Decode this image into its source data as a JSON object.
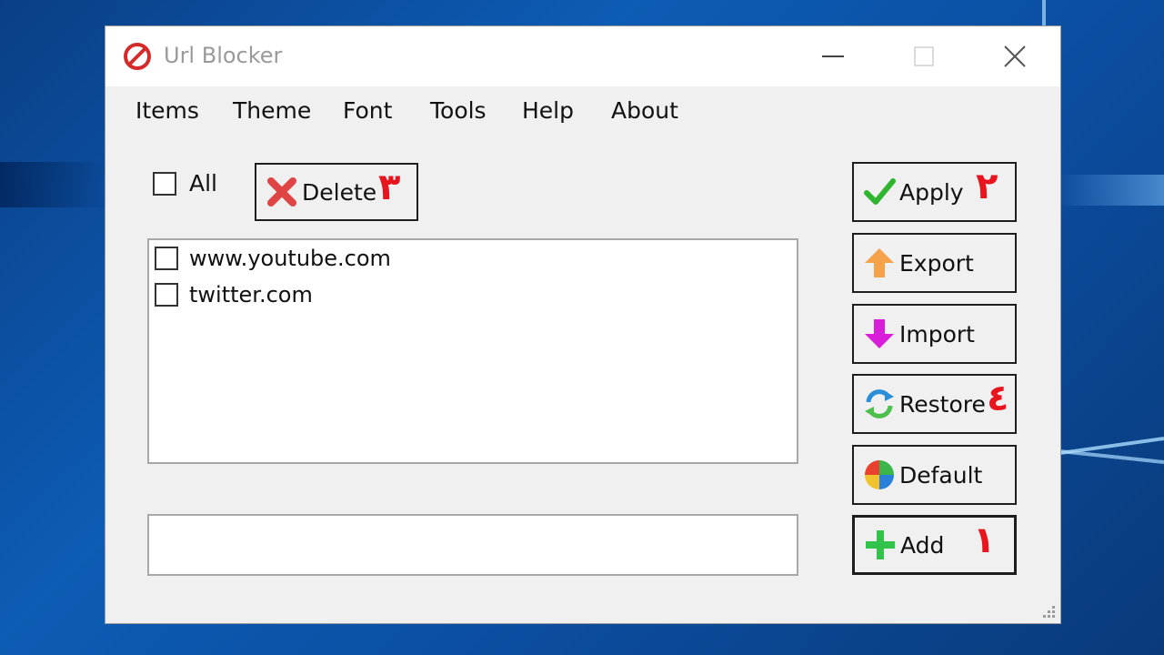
{
  "window": {
    "title": "Url Blocker"
  },
  "menu": [
    "Items",
    "Theme",
    "Font",
    "Tools",
    "Help",
    "About"
  ],
  "select_all": {
    "label": "All",
    "checked": false
  },
  "delete_button": {
    "label": "Delete",
    "number": "٣"
  },
  "url_list": [
    {
      "url": "www.youtube.com",
      "checked": false
    },
    {
      "url": "twitter.com",
      "checked": false
    }
  ],
  "url_input": {
    "value": "",
    "placeholder": ""
  },
  "side_buttons": {
    "apply": {
      "label": "Apply",
      "number": "٢"
    },
    "export": {
      "label": "Export"
    },
    "import": {
      "label": "Import"
    },
    "restore": {
      "label": "Restore",
      "number": "٤"
    },
    "default": {
      "label": "Default"
    },
    "add": {
      "label": "Add",
      "number": "١"
    }
  },
  "colors": {
    "title_gray": "#9a9a9a",
    "annotation_red": "#e8141e",
    "window_bg": "#f0f0f0",
    "desktop_blue": "#0d5cb5"
  }
}
